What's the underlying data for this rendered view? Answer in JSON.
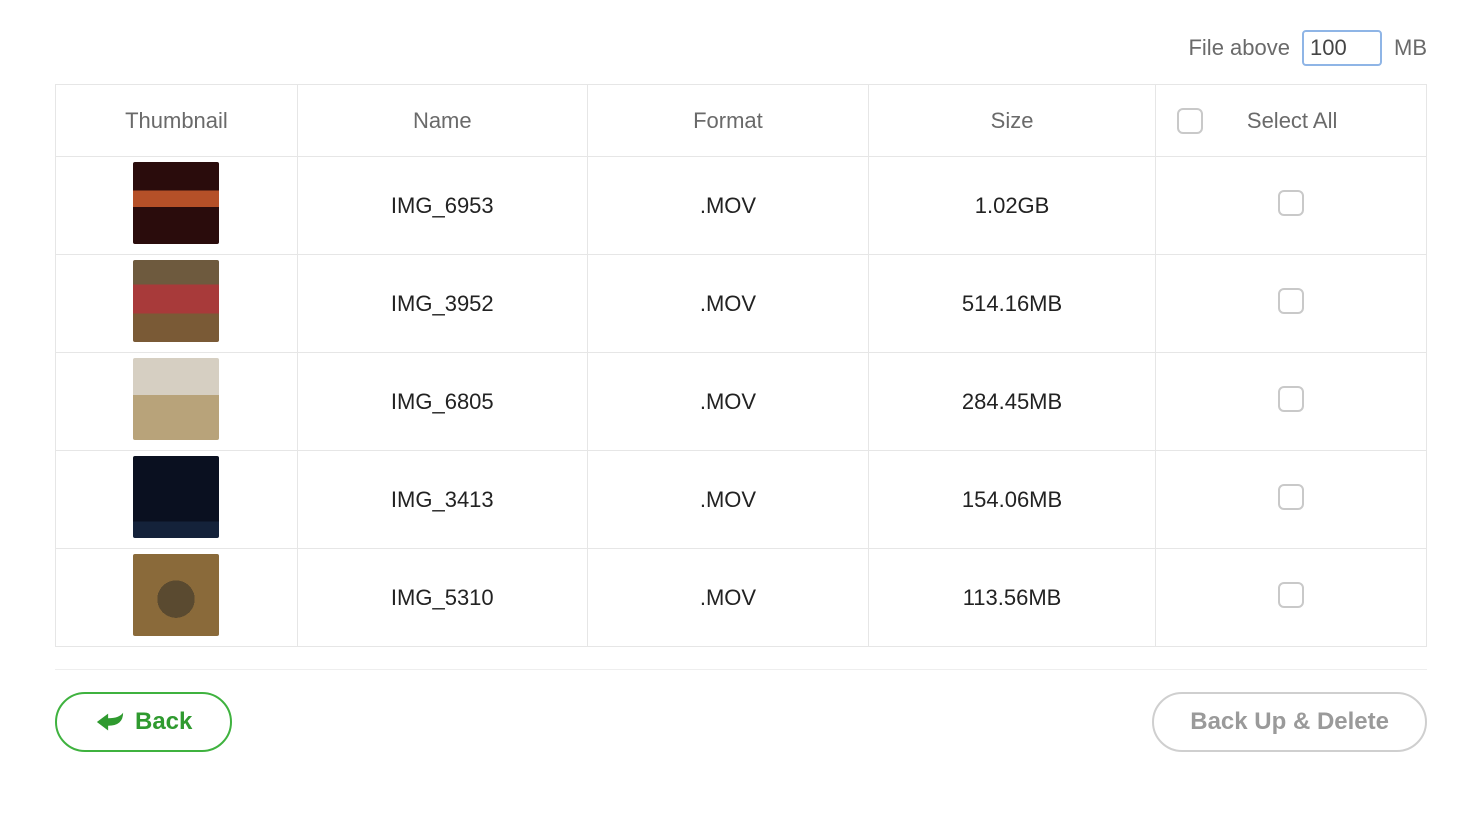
{
  "filter": {
    "label": "File above",
    "value": "100",
    "unit": "MB"
  },
  "columns": {
    "thumbnail": "Thumbnail",
    "name": "Name",
    "format": "Format",
    "size": "Size",
    "select_all": "Select All"
  },
  "rows": [
    {
      "name": "IMG_6953",
      "format": ".MOV",
      "size": "1.02GB",
      "selected": false
    },
    {
      "name": "IMG_3952",
      "format": ".MOV",
      "size": "514.16MB",
      "selected": false
    },
    {
      "name": "IMG_6805",
      "format": ".MOV",
      "size": "284.45MB",
      "selected": false
    },
    {
      "name": "IMG_3413",
      "format": ".MOV",
      "size": "154.06MB",
      "selected": false
    },
    {
      "name": "IMG_5310",
      "format": ".MOV",
      "size": "113.56MB",
      "selected": false
    }
  ],
  "footer": {
    "back_label": "Back",
    "backup_delete_label": "Back Up & Delete"
  }
}
